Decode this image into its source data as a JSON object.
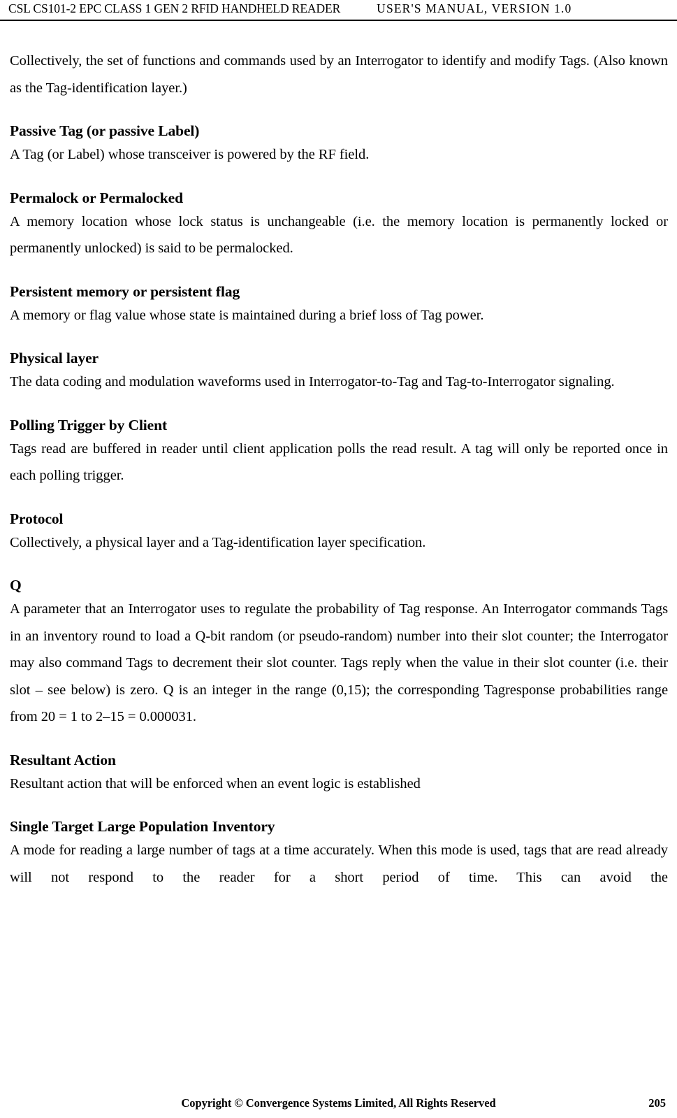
{
  "header": {
    "left": "CSL CS101-2 EPC CLASS 1 GEN 2 RFID HANDHELD READER",
    "right": "USER'S  MANUAL,  VERSION  1.0"
  },
  "content": {
    "intro_paragraph": "Collectively, the set of functions and commands used by an Interrogator to identify and modify Tags. (Also known as the Tag-identification layer.)",
    "entries": [
      {
        "term": "Passive Tag (or passive Label)",
        "definition": "A Tag (or Label) whose transceiver is powered by the RF field."
      },
      {
        "term": "Permalock or Permalocked",
        "definition": "A memory location whose lock status is unchangeable (i.e. the memory location is permanently locked or permanently unlocked) is said to be permalocked."
      },
      {
        "term": "Persistent memory or persistent flag",
        "definition": "A memory or flag value whose state is maintained during a brief loss of Tag power."
      },
      {
        "term": "Physical layer",
        "definition": "The data coding and modulation waveforms used in Interrogator-to-Tag and Tag-to-Interrogator signaling."
      },
      {
        "term": "Polling Trigger by Client",
        "definition": "Tags read are buffered in reader until client application polls the read result. A tag will only be reported once in each polling trigger."
      },
      {
        "term": "Protocol",
        "definition": "Collectively, a physical layer and a Tag-identification layer specification."
      },
      {
        "term": "Q",
        "definition": "A parameter that an Interrogator uses to regulate the probability of Tag response. An Interrogator commands Tags in an inventory round to load a Q-bit random (or pseudo-random) number into their slot counter; the Interrogator may also command Tags to decrement their slot counter. Tags reply when the value in their slot counter (i.e. their slot – see below) is zero. Q is an integer in the range (0,15); the corresponding Tagresponse probabilities range from 20 = 1 to 2–15 = 0.000031."
      },
      {
        "term": "Resultant Action",
        "definition": "Resultant action that will be enforced when an event logic is established"
      },
      {
        "term": "Single Target Large Population Inventory",
        "definition": "A mode for reading a large number of tags at a time accurately. When this mode is used, tags that are read already will not respond to the reader for a short period of time. This can avoid the"
      }
    ]
  },
  "footer": {
    "copyright": "Copyright © Convergence Systems Limited, All Rights Reserved",
    "page_number": "205"
  }
}
